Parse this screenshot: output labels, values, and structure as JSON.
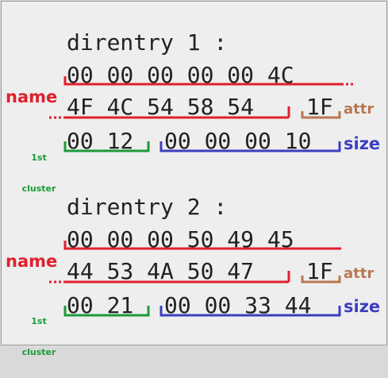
{
  "colors": {
    "name": "#e0202e",
    "attr": "#b87852",
    "cluster": "#1e9a3a",
    "size": "#3c3ec0",
    "text": "#222222",
    "background": "#eeeeee"
  },
  "labels": {
    "name": "name",
    "attr": "attr",
    "size": "size",
    "cluster_line1": "1st",
    "cluster_line2": "cluster"
  },
  "entries": [
    {
      "title": "direntry 1 :",
      "row1": "00 00 00 00 00 4C",
      "row2_name": "4F 4C 54 58 54",
      "row2_attr": "1F",
      "row3_cluster": "00 12",
      "row3_size": "00 00 00 10"
    },
    {
      "title": "direntry 2 :",
      "row1": "00 00 00 50 49 45",
      "row2_name": "44 53 4A 50 47",
      "row2_attr": "1F",
      "row3_cluster": "00 21",
      "row3_size": "00 00 33 44"
    }
  ]
}
